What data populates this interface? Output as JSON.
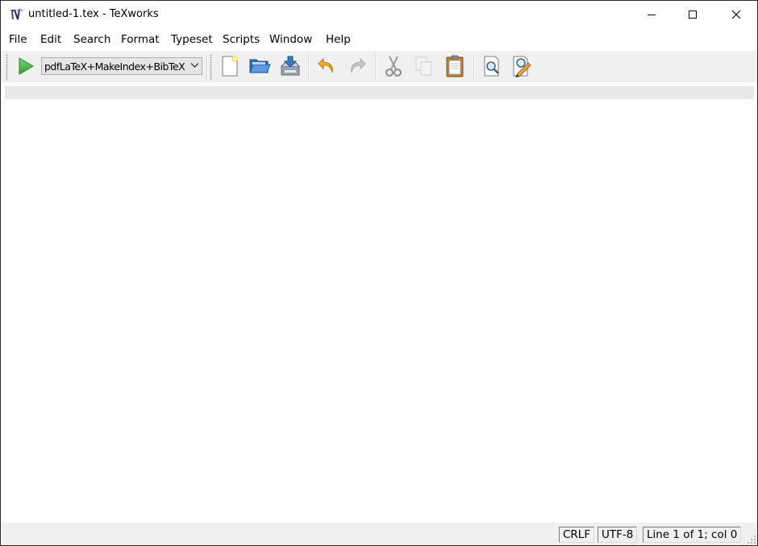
{
  "window": {
    "title": "untitled-1.tex - TeXworks"
  },
  "menu": {
    "items": [
      "File",
      "Edit",
      "Search",
      "Format",
      "Typeset",
      "Scripts",
      "Window",
      "Help"
    ]
  },
  "toolbar": {
    "typeset_engine": "pdfLaTeX+MakeIndex+BibTeX",
    "buttons": [
      {
        "icon": "typeset-play-icon",
        "enabled": true
      },
      {
        "icon": "new-document-icon",
        "enabled": true
      },
      {
        "icon": "open-folder-icon",
        "enabled": true
      },
      {
        "icon": "save-icon",
        "enabled": true
      },
      {
        "icon": "undo-icon",
        "enabled": true
      },
      {
        "icon": "redo-icon",
        "enabled": false
      },
      {
        "icon": "cut-icon",
        "enabled": false
      },
      {
        "icon": "copy-icon",
        "enabled": false
      },
      {
        "icon": "paste-icon",
        "enabled": true
      },
      {
        "icon": "find-icon",
        "enabled": true
      },
      {
        "icon": "replace-icon",
        "enabled": true
      }
    ]
  },
  "editor": {
    "content": ""
  },
  "statusbar": {
    "line_ending": "CRLF",
    "encoding": "UTF-8",
    "position": "Line 1 of 1; col 0"
  },
  "colors": {
    "play_green": "#3cb44a",
    "folder_blue": "#3a78c2",
    "undo_orange": "#e8a317",
    "toolbar_bg": "#f0f0f0",
    "current_line_bg": "#e8e8e8"
  }
}
